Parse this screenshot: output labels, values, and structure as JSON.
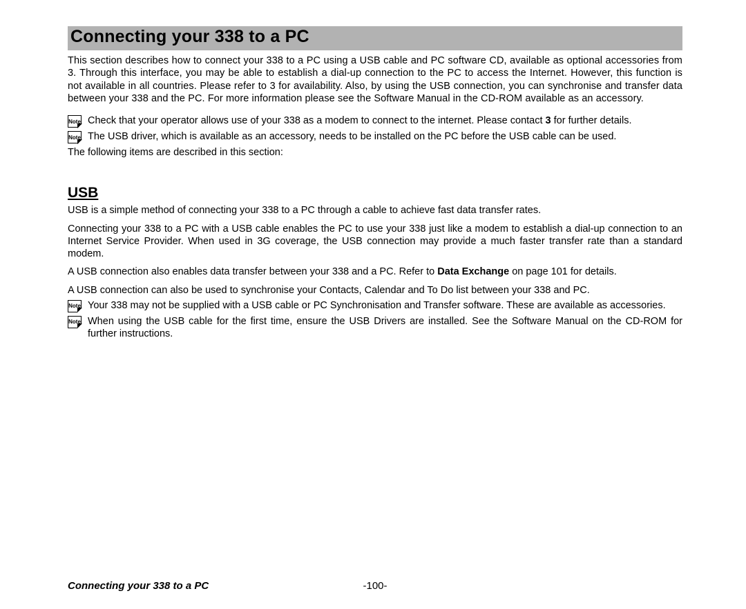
{
  "title": "Connecting your 338 to a PC",
  "intro": "This section describes how to connect your 338 to a PC using a USB cable and PC software CD, available as optional accessories from 3. Through this interface, you may be able to establish a dial-up connection to the PC to access the Internet. However, this function is not available in all countries. Please refer to 3 for availability. Also, by using the USB connection, you can synchronise and transfer data between your 338 and the PC. For more information please see the Software Manual in the CD-ROM available as an accessory.",
  "note1_pre": "Check that your operator allows use of your 338 as a modem to connect to the internet. Please contact ",
  "note1_bold": "3",
  "note1_post": " for further details.",
  "note2": "The USB driver, which is available as an accessory, needs to be installed on the PC before the USB cable can be used.",
  "following_line": "The following items are described in this section:",
  "usb_heading": "USB",
  "usb_p1": "USB is a simple method of connecting your 338 to a PC through a cable to achieve fast data transfer rates.",
  "usb_p2": "Connecting your 338 to a PC with a USB cable enables the PC to use your 338 just like a modem to establish a dial-up connection to an Internet Service Provider. When used in 3G coverage, the USB connection may provide a much faster transfer rate than a standard modem.",
  "usb_p3_pre": "A USB connection also enables data transfer between your 338 and a PC. Refer to ",
  "usb_p3_bold": "Data Exchange",
  "usb_p3_post": " on page 101 for details.",
  "usb_p4": "A USB connection can also be used to synchronise your Contacts, Calendar and To Do list between your 338 and PC.",
  "usb_note1": "Your 338 may not be supplied with a USB cable or PC Synchronisation and Transfer software. These are available as accessories.",
  "usb_note2": "When using the USB cable for the first time, ensure the USB Drivers are installed. See the Software Manual on the CD-ROM for further instructions.",
  "note_icon_label": "Note",
  "footer_title": "Connecting your 338 to a PC",
  "page_number": "-100-"
}
